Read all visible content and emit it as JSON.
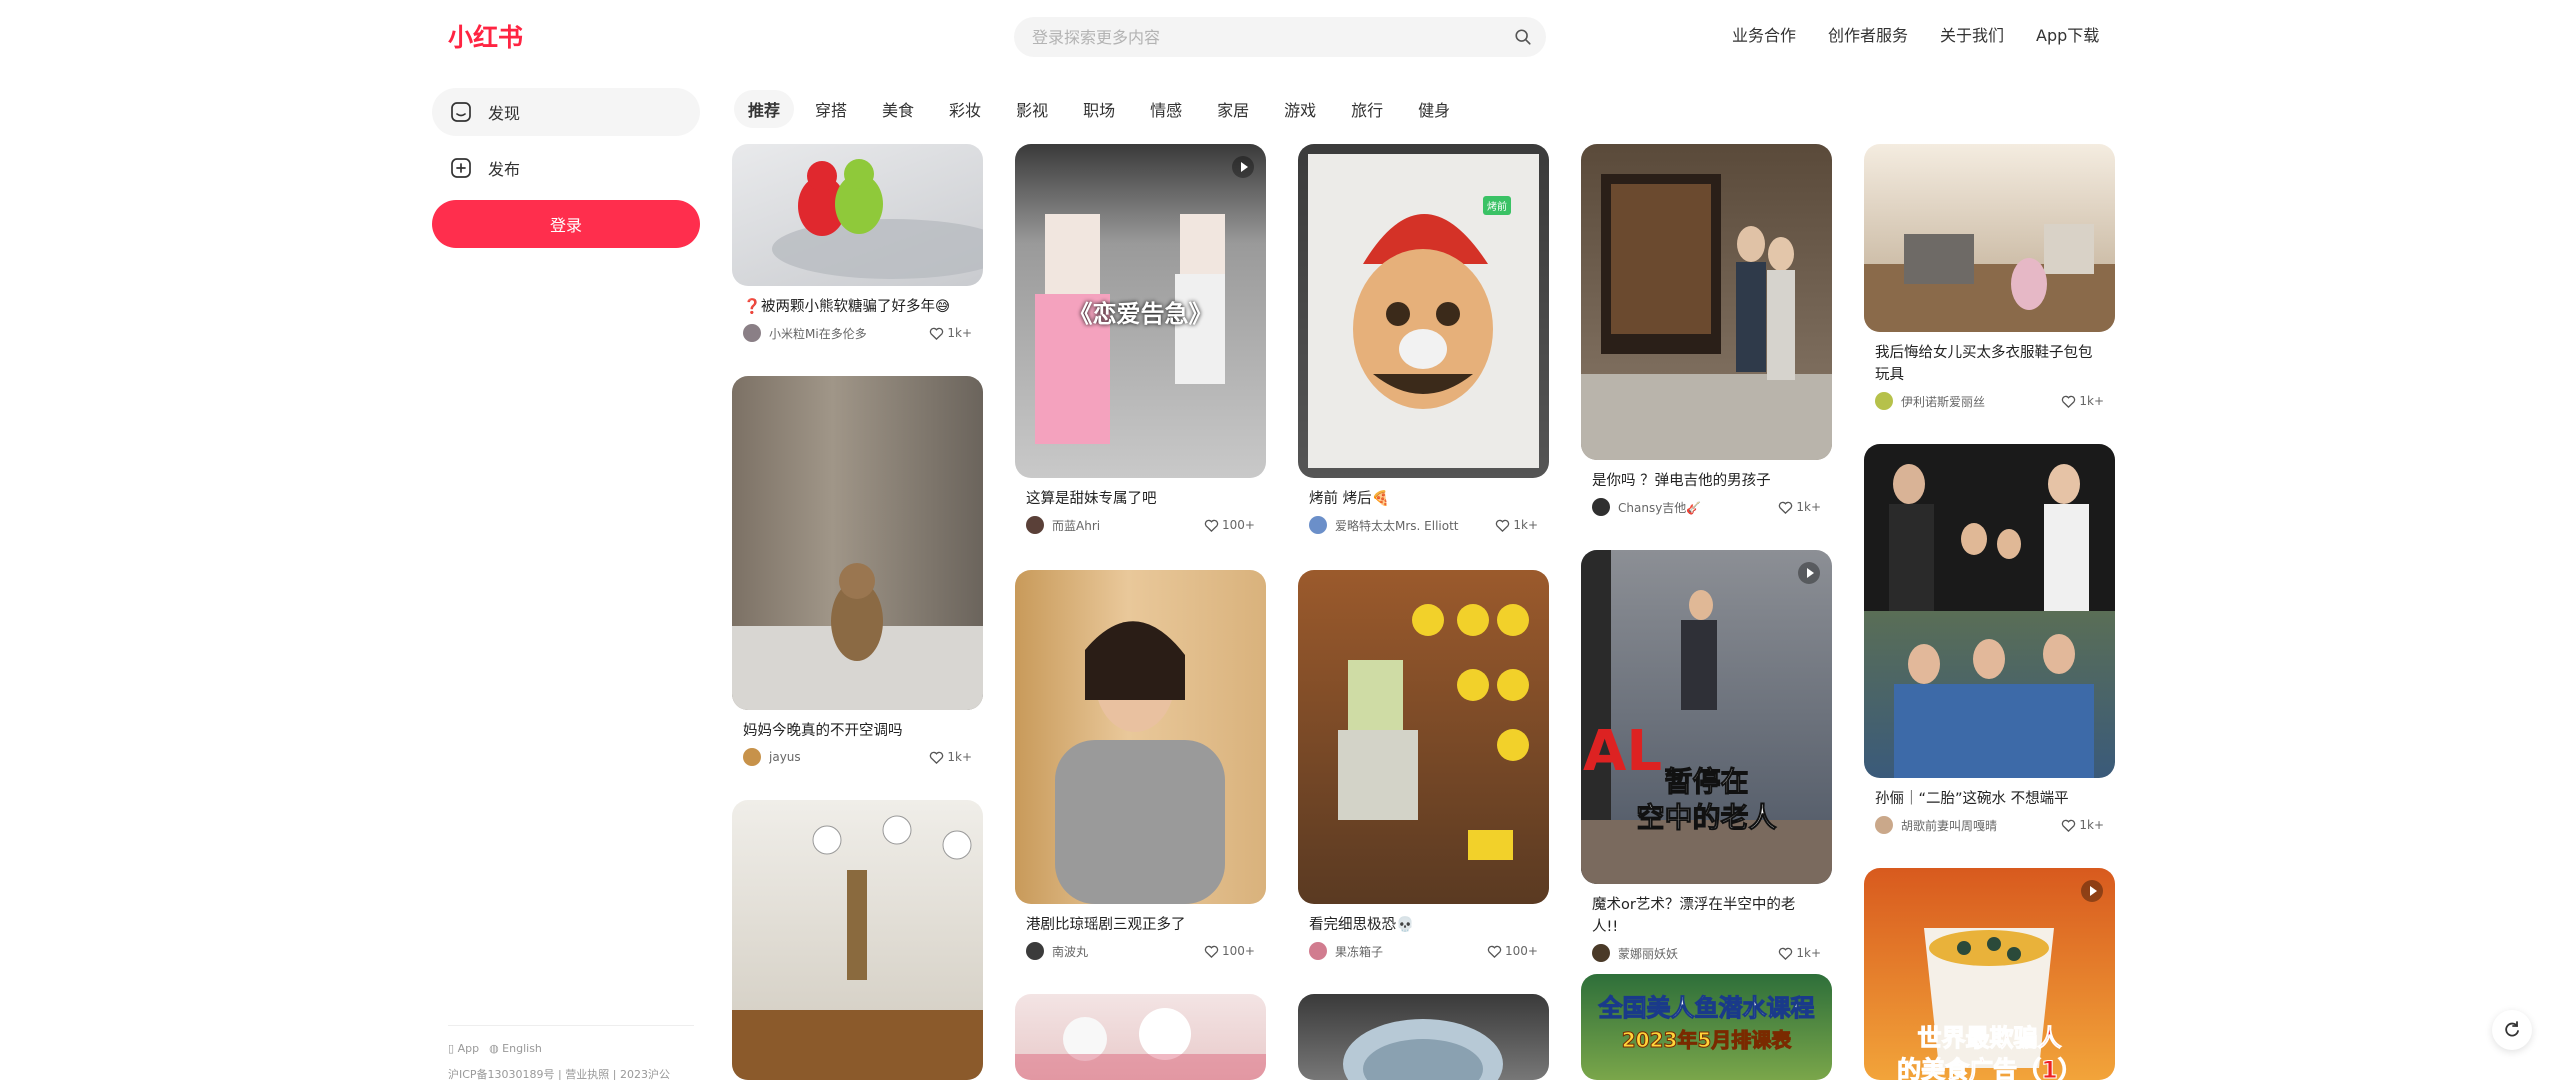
{
  "header": {
    "logo": "小红书",
    "search_placeholder": "登录探索更多内容",
    "nav": [
      "业务合作",
      "创作者服务",
      "关于我们",
      "App下载"
    ]
  },
  "sidebar": {
    "items": [
      {
        "label": "发现",
        "icon": "discover-icon"
      },
      {
        "label": "发布",
        "icon": "publish-icon"
      }
    ],
    "login": "登录",
    "footer": {
      "app": "App",
      "lang": "English",
      "icp": "沪ICP备13030189号 | 营业执照 | 2023沪公"
    }
  },
  "categories": [
    "推荐",
    "穿搭",
    "美食",
    "彩妆",
    "影视",
    "职场",
    "情感",
    "家居",
    "游戏",
    "旅行",
    "健身"
  ],
  "cards": [
    {
      "title": "❓被两颗小熊软糖骗了好多年😅",
      "author": "小米粒Mi在多伦多",
      "likes": "1k+"
    },
    {
      "title": "妈妈今晚真的不开空调吗",
      "author": "jayus",
      "likes": "1k+"
    },
    {
      "title": "",
      "author": "",
      "likes": ""
    },
    {
      "title": "这算是甜妹专属了吧",
      "author": "而蓝Ahri",
      "likes": "100+",
      "overlay": "《恋爱告急》"
    },
    {
      "title": "港剧比琼瑶剧三观正多了",
      "author": "南波丸",
      "likes": "100+"
    },
    {
      "title": "",
      "author": "",
      "likes": ""
    },
    {
      "title": "烤前 烤后🍕",
      "author": "爱略特太太Mrs. Elliott",
      "likes": "1k+",
      "tag": "烤前"
    },
    {
      "title": "看完细思极恐💀",
      "author": "果冻箱子",
      "likes": "100+"
    },
    {
      "title": "",
      "author": "",
      "likes": ""
    },
    {
      "title": "是你吗 ？弹电吉他的男孩子",
      "author": "Chansy吉他🎸",
      "likes": "1k+"
    },
    {
      "title": "魔术or艺术？漂浮在半空中的老人!!",
      "author": "蒙娜丽妖妖",
      "likes": "1k+",
      "overlay1": "暂停在",
      "overlay2": "空中的老人"
    },
    {
      "title": "",
      "author": "",
      "likes": "",
      "overlay1": "全国美人鱼潜水课程",
      "overlay2": "2023年5月排课表"
    },
    {
      "title": "我后悔给女儿买太多衣服鞋子包包玩具",
      "author": "伊利诺斯爱丽丝",
      "likes": "1k+"
    },
    {
      "title": "孙俪｜“二胎”这碗水 不想端平",
      "author": "胡歌前妻叫周嘎晴",
      "likes": "1k+"
    },
    {
      "title": "",
      "author": "",
      "likes": "",
      "overlay1": "世界最欺骗人",
      "overlay2": "的美食广告（1）"
    }
  ]
}
